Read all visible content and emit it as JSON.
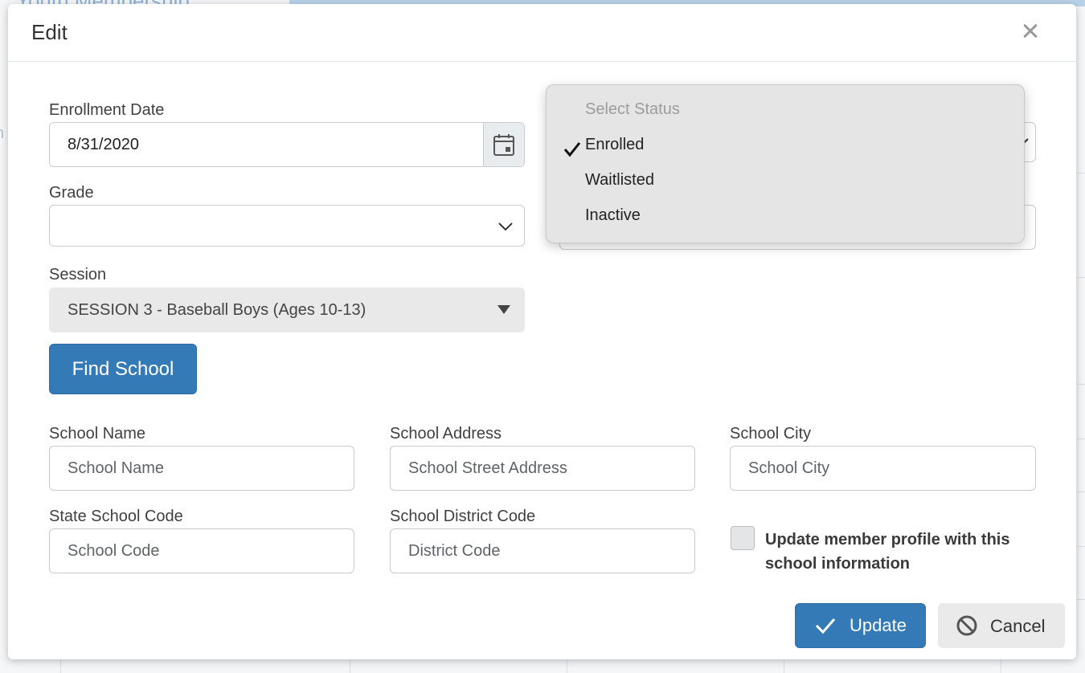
{
  "background": {
    "page_title": "Youth Membership"
  },
  "modal": {
    "title": "Edit",
    "close_icon": "close-icon"
  },
  "fields": {
    "enrollment_date": {
      "label": "Enrollment Date",
      "value": "8/31/2020",
      "icon": "calendar-icon"
    },
    "grade": {
      "label": "Grade",
      "value": ""
    },
    "session": {
      "label": "Session",
      "value": "SESSION 3 - Baseball Boys (Ages 10-13)"
    },
    "find_school_label": "Find School",
    "school_name": {
      "label": "School Name",
      "placeholder": "School Name"
    },
    "school_address": {
      "label": "School Address",
      "placeholder": "School Street Address"
    },
    "school_city": {
      "label": "School City",
      "placeholder": "School City"
    },
    "state_school_code": {
      "label": "State School Code",
      "placeholder": "School Code"
    },
    "school_district_code": {
      "label": "School District Code",
      "placeholder": "District Code"
    },
    "update_profile": {
      "label": "Update member profile with this school information",
      "checked": false
    }
  },
  "status_dropdown": {
    "options": [
      {
        "label": "Select Status",
        "disabled": true
      },
      {
        "label": "Enrolled",
        "selected": true
      },
      {
        "label": "Waitlisted"
      },
      {
        "label": "Inactive"
      }
    ]
  },
  "footer": {
    "update_label": "Update",
    "update_icon": "checkmark-icon",
    "cancel_label": "Cancel",
    "cancel_icon": "ban-icon"
  },
  "colors": {
    "primary": "#337ab7",
    "cancel_bg": "#eaeaea",
    "dropdown_bg": "#e5e5e5"
  }
}
